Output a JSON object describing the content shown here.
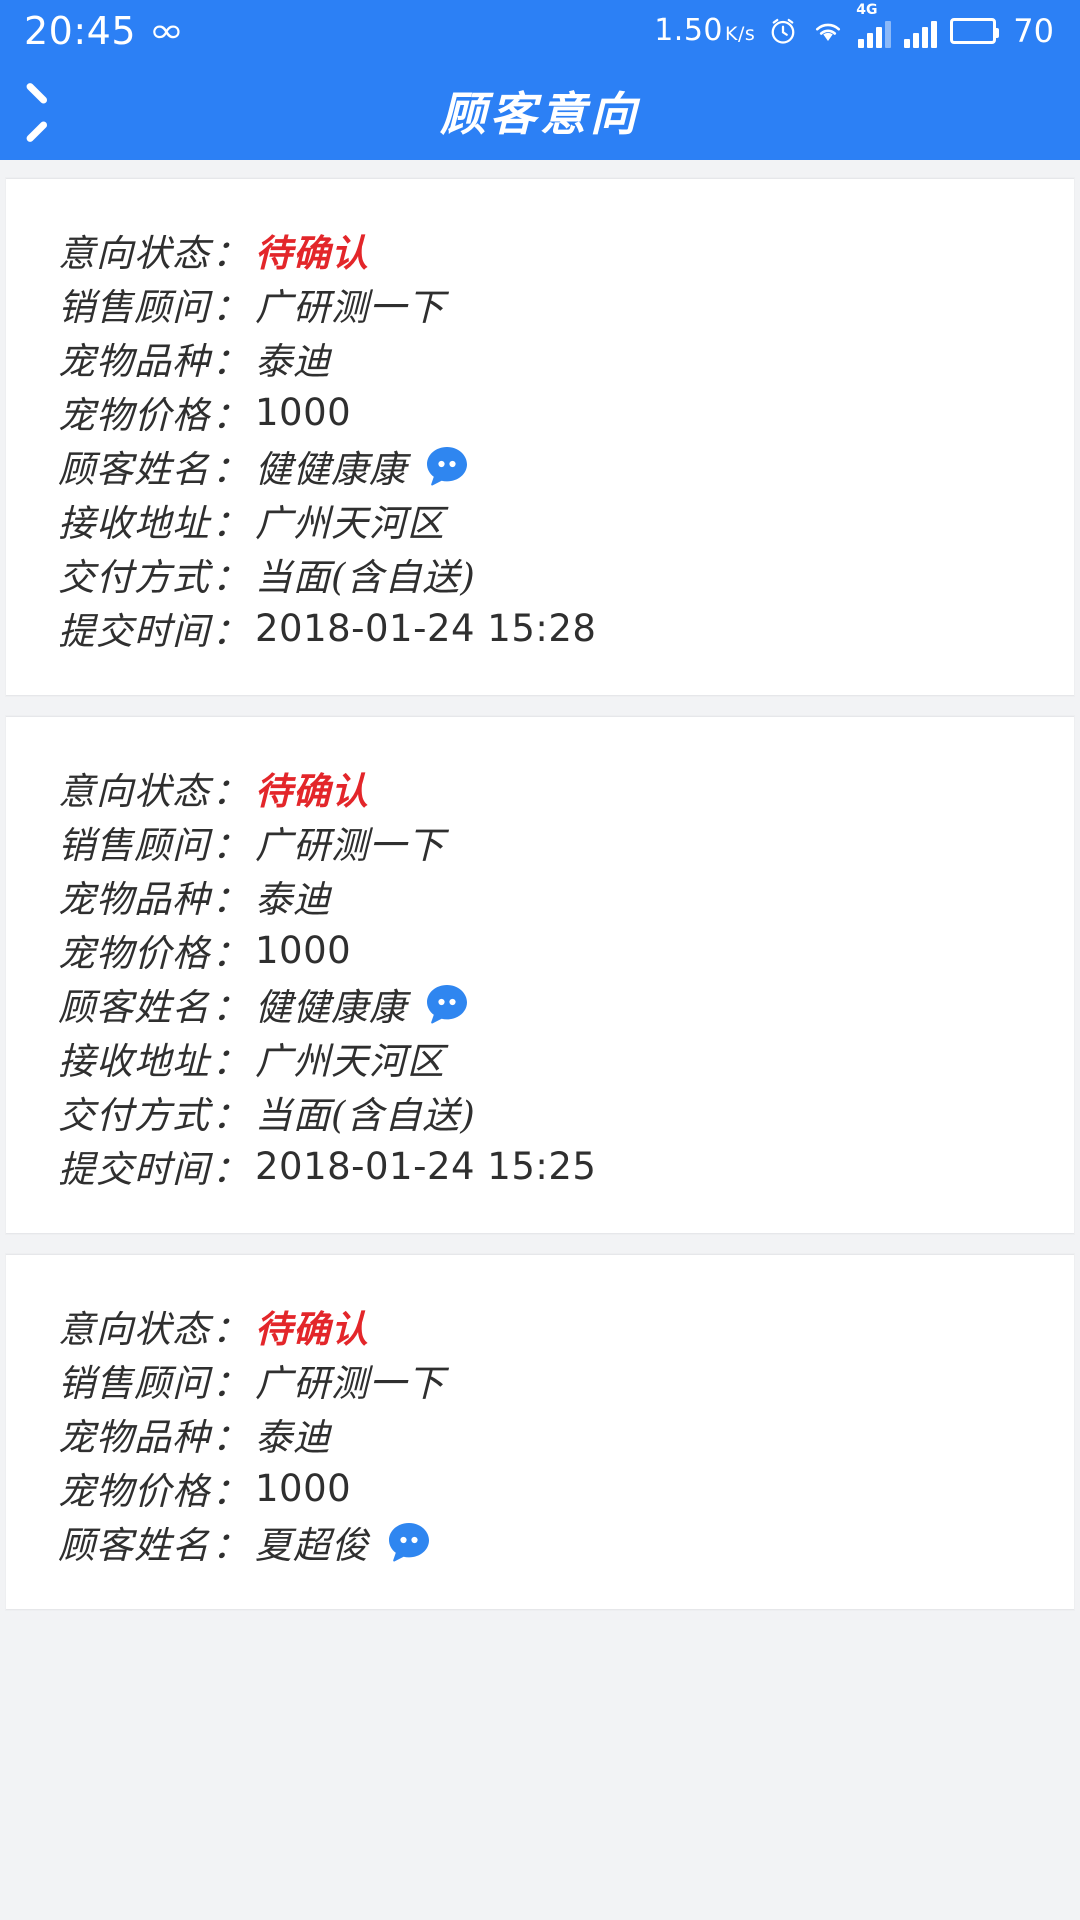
{
  "theme": {
    "brand_color": "#2c80f5",
    "status_text_color": "#e3262a",
    "page_background": "#f2f3f5",
    "card_background": "#ffffff"
  },
  "status_bar": {
    "clock": "20:45",
    "infinity_glyph": "∞",
    "network_speed": "1.50",
    "network_speed_unit": "K/s",
    "signal_label_4g": "4G",
    "battery_percent": "70",
    "icons": [
      "infinity-icon",
      "alarm-icon",
      "wifi-icon",
      "signal-4g-icon",
      "signal-icon",
      "battery-icon"
    ]
  },
  "app_bar": {
    "back_label": "返回",
    "title": "顾客意向"
  },
  "labels": {
    "intent_status": "意向状态",
    "sales_advisor": "销售顾问",
    "pet_breed": "宠物品种",
    "pet_price": "宠物价格",
    "customer_name": "顾客姓名",
    "receiving_address": "接收地址",
    "delivery_method": "交付方式",
    "submit_time": "提交时间",
    "colon": "："
  },
  "cards": [
    {
      "intent_status": "待确认",
      "sales_advisor": "广研测一下",
      "pet_breed": "泰迪",
      "pet_price": "1000",
      "customer_name": "健健康康",
      "receiving_address": "广州天河区",
      "delivery_method": "当面(含自送)",
      "submit_time": "2018-01-24 15:28",
      "chat_icon": "chat-bubble-icon"
    },
    {
      "intent_status": "待确认",
      "sales_advisor": "广研测一下",
      "pet_breed": "泰迪",
      "pet_price": "1000",
      "customer_name": "健健康康",
      "receiving_address": "广州天河区",
      "delivery_method": "当面(含自送)",
      "submit_time": "2018-01-24 15:25",
      "chat_icon": "chat-bubble-icon"
    },
    {
      "intent_status": "待确认",
      "sales_advisor": "广研测一下",
      "pet_breed": "泰迪",
      "pet_price": "1000",
      "customer_name": "夏超俊",
      "receiving_address": "",
      "delivery_method": "",
      "submit_time": "",
      "chat_icon": "chat-bubble-icon"
    }
  ]
}
